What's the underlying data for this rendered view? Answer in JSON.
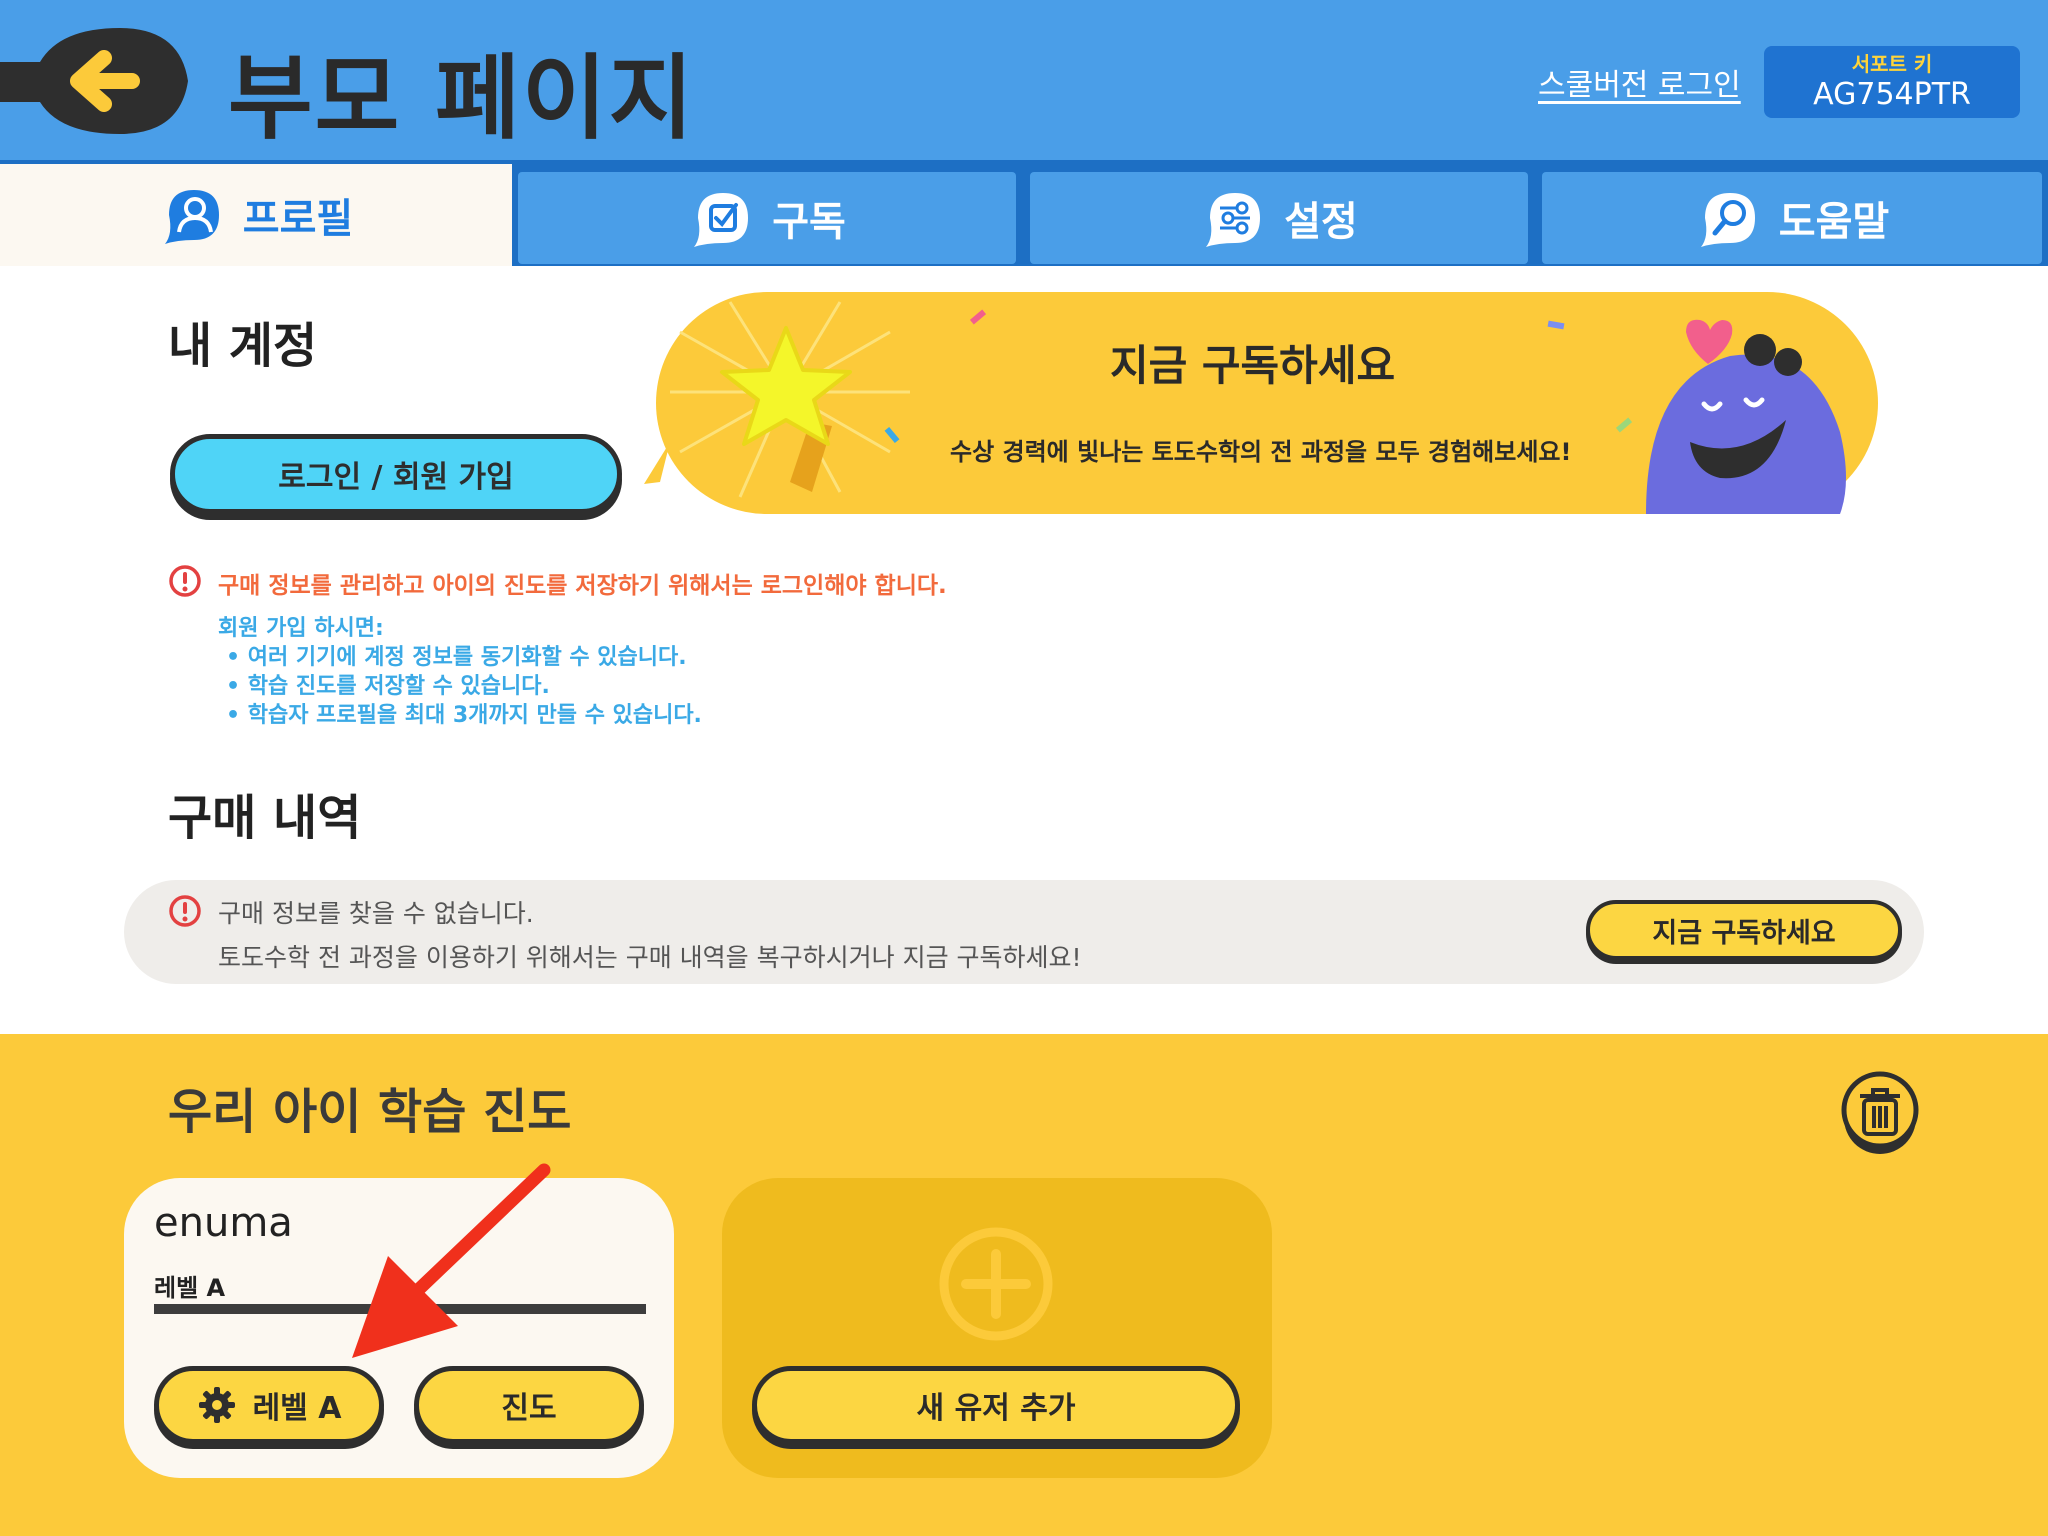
{
  "header": {
    "title": "부모 페이지",
    "school_login": "스쿨버전 로그인",
    "support_key_label": "서포트 키",
    "support_key_value": "AG754PTR"
  },
  "tabs": [
    {
      "label": "프로필",
      "icon": "user-icon",
      "active": true
    },
    {
      "label": "구독",
      "icon": "checkbox-icon",
      "active": false
    },
    {
      "label": "설정",
      "icon": "settings-sliders-icon",
      "active": false
    },
    {
      "label": "도움말",
      "icon": "magnifier-icon",
      "active": false
    }
  ],
  "account": {
    "heading": "내 계정",
    "login_button": "로그인 / 회원 가입",
    "warning": "구매 정보를 관리하고 아이의 진도를 저장하기 위해서는 로그인해야 합니다.",
    "benefits_title": "회원 가입 하시면:",
    "benefits": [
      "여러 기기에 계정 정보를 동기화할 수 있습니다.",
      "학습 진도를 저장할 수 있습니다.",
      "학습자 프로필을 최대 3개까지 만들 수 있습니다."
    ]
  },
  "promo": {
    "title": "지금 구독하세요",
    "subtitle": "수상 경력에 빛나는 토도수학의 전 과정을 모두 경험해보세요!"
  },
  "purchase": {
    "heading": "구매 내역",
    "line1": "구매 정보를 찾을 수 없습니다.",
    "line2": "토도수학 전 과정을 이용하기 위해서는 구매 내역을 복구하시거나 지금 구독하세요!",
    "subscribe_button": "지금 구독하세요"
  },
  "progress": {
    "heading": "우리 아이 학습 진도",
    "user": {
      "name": "enuma",
      "level": "레벨 A",
      "progress_fraction": 1.0,
      "level_button": "레벨 A",
      "progress_button": "진도"
    },
    "add_user_button": "새 유저 추가"
  },
  "colors": {
    "header_blue": "#4a9ee8",
    "tab_dark_blue": "#1d6fc4",
    "accent_yellow": "#fcca3a",
    "warning_orange": "#f26a3c",
    "info_blue": "#3aa9e6",
    "login_cyan": "#4fd4f7"
  }
}
